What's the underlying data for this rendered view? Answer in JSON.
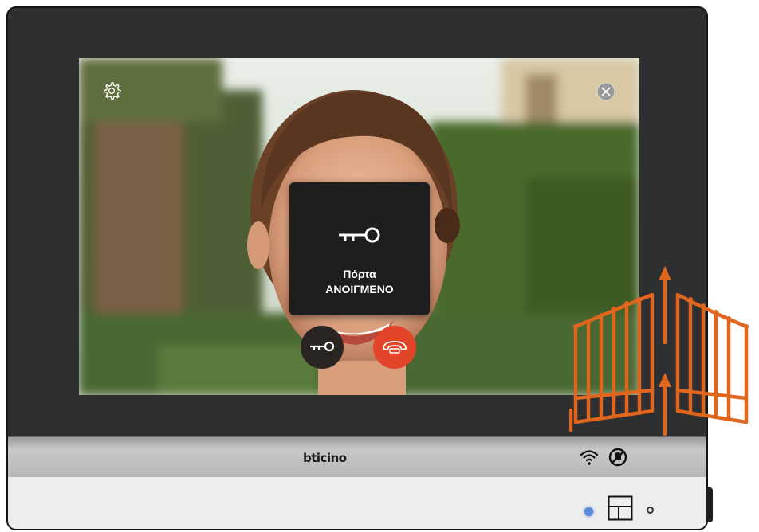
{
  "screen": {
    "popup": {
      "icon": "key-icon",
      "title": "Πόρτα",
      "status": "ΑΝΟΙΓΜΕΝΟ"
    },
    "top_icons": [
      "gear-icon",
      "close-icon"
    ],
    "action_buttons": [
      {
        "icon": "key-icon",
        "color": "#2a2522"
      },
      {
        "icon": "hang-up-phone-icon",
        "color": "#e2452a"
      }
    ]
  },
  "device": {
    "brand": "bticino",
    "status_icons": [
      "wifi-icon",
      "mute-ringtone-icon"
    ],
    "led_color": "#5a8ad6"
  },
  "overlay": {
    "icon": "gate-opening-icon",
    "color": "#e0661d"
  }
}
